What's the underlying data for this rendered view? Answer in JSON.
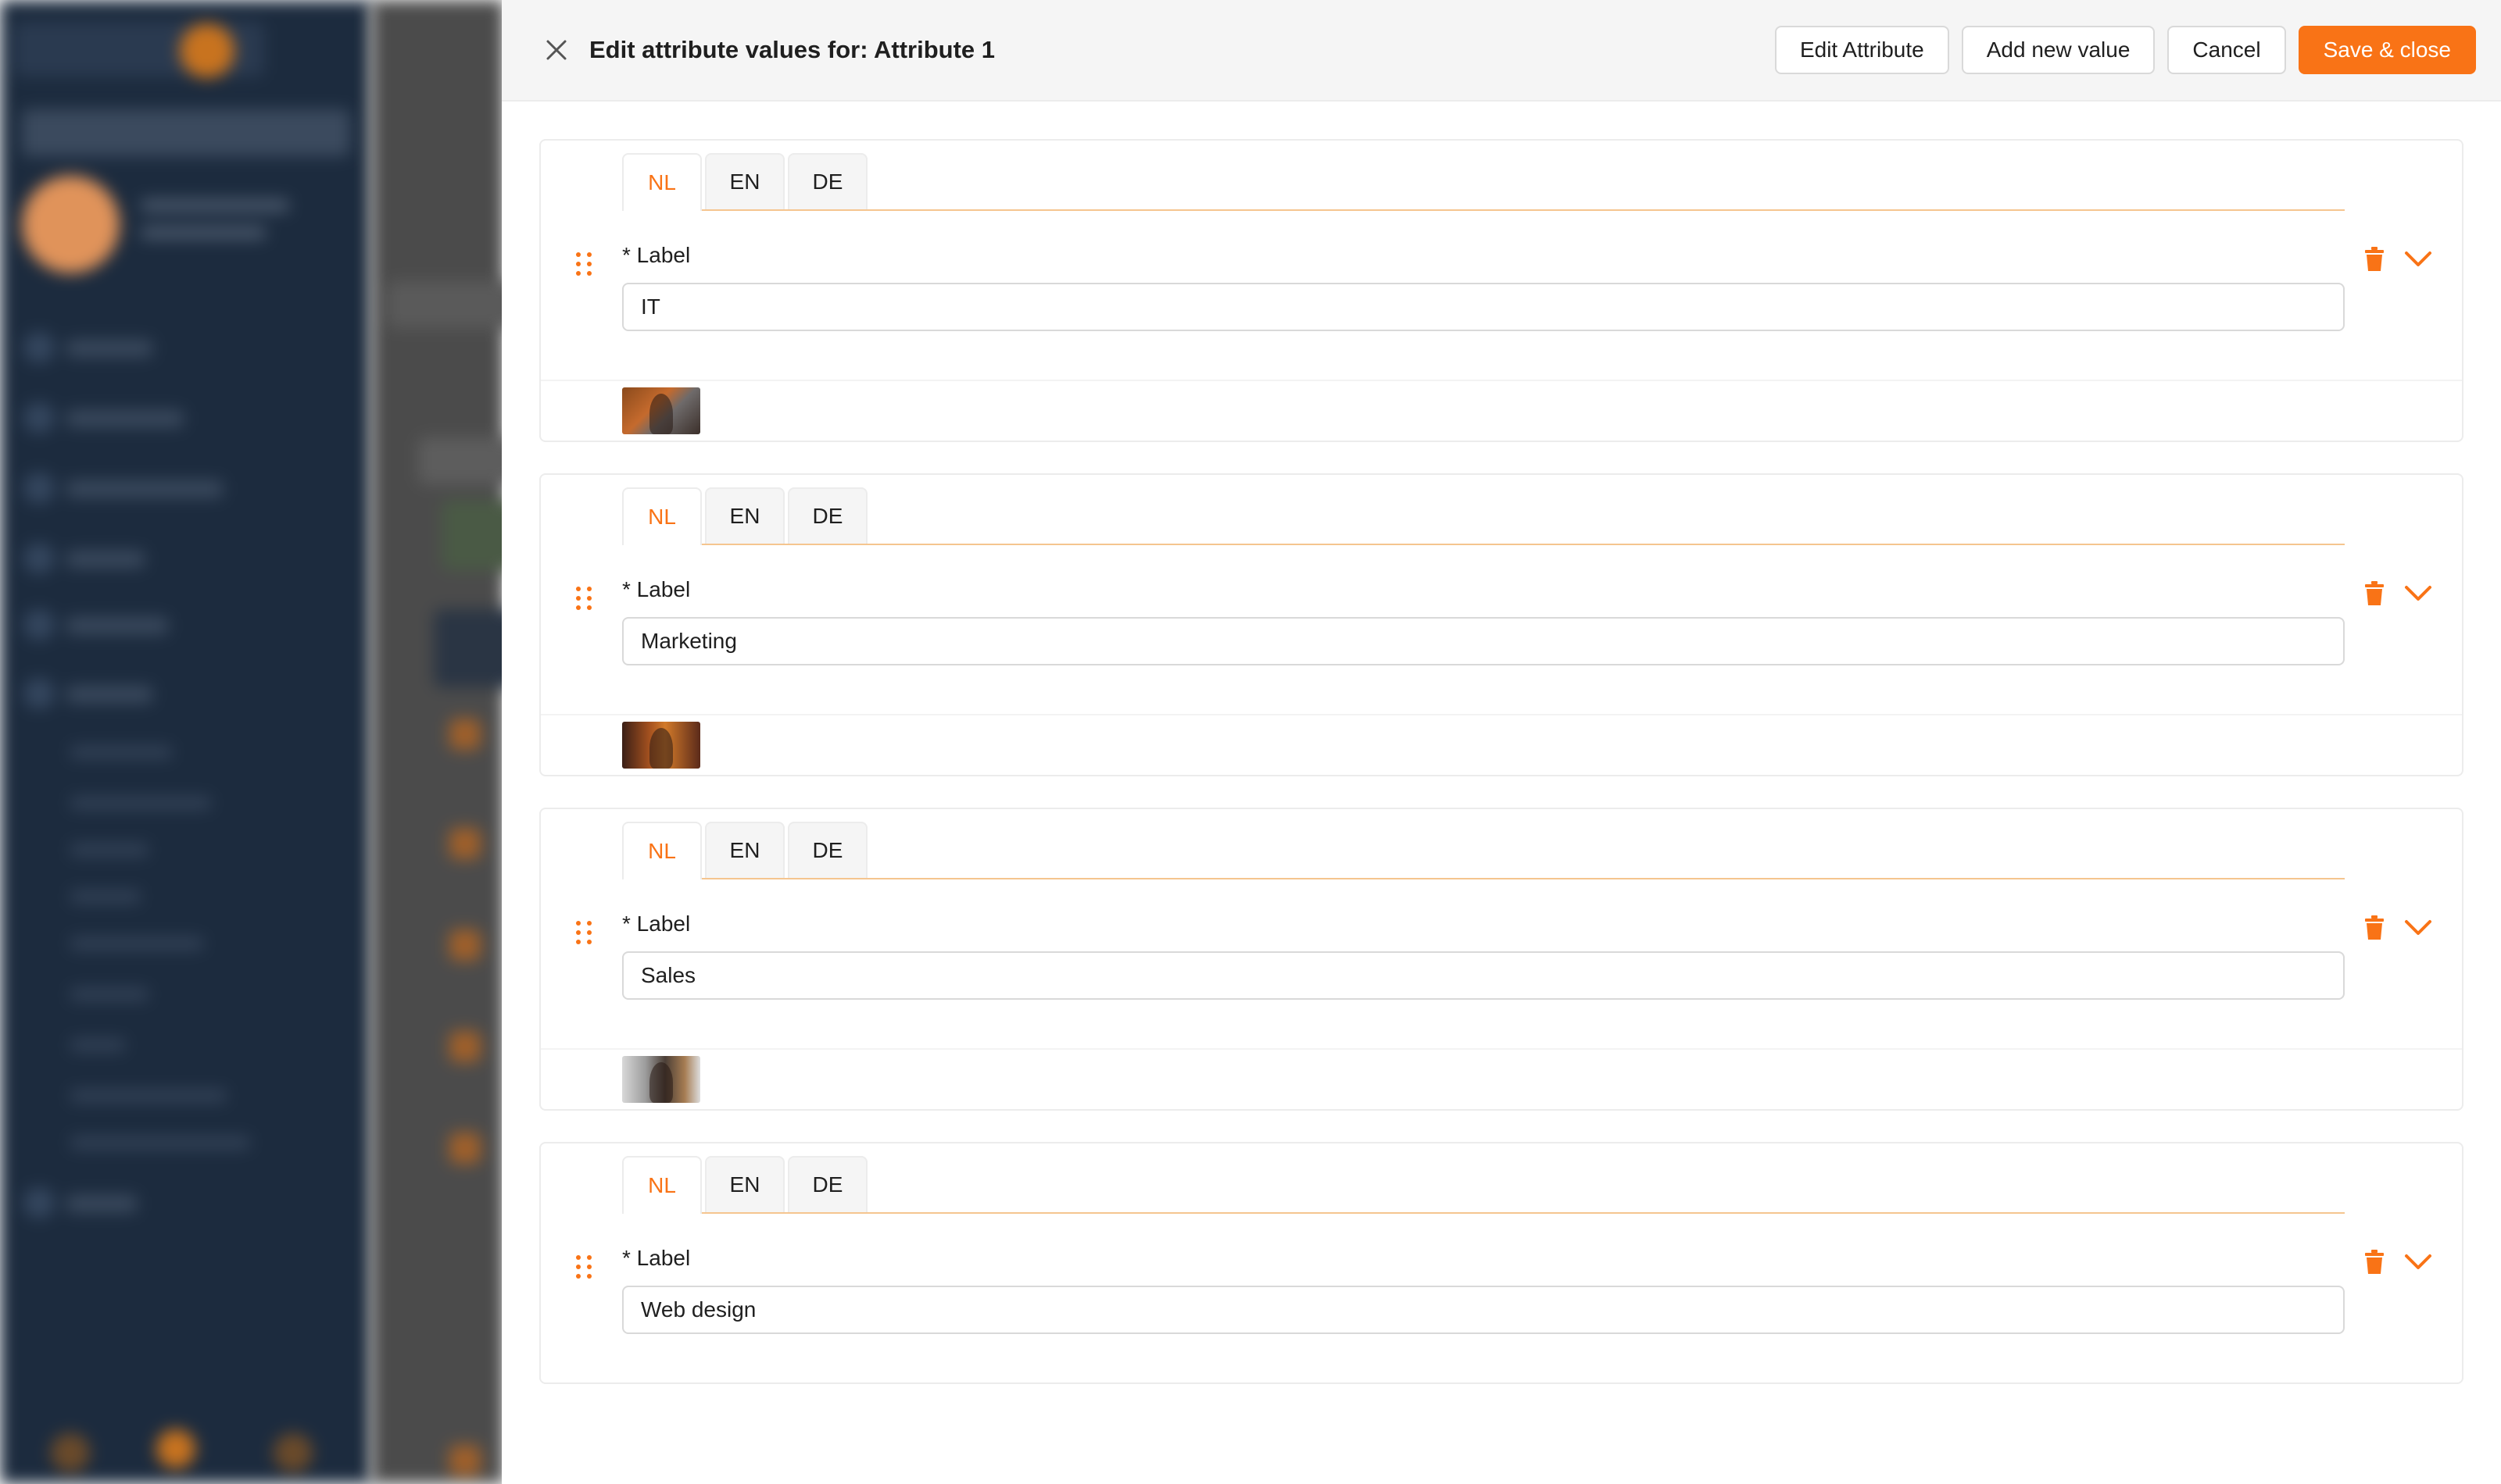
{
  "drawer": {
    "title": "Edit attribute values for: Attribute 1",
    "close_icon": "close-icon",
    "buttons": {
      "edit_attribute": "Edit Attribute",
      "add_new_value": "Add new value",
      "cancel": "Cancel",
      "save_close": "Save & close"
    }
  },
  "languages": [
    "NL",
    "EN",
    "DE"
  ],
  "active_language": "NL",
  "values": [
    {
      "label": "* Label",
      "value": "IT",
      "has_image": true
    },
    {
      "label": "* Label",
      "value": "Marketing",
      "has_image": true
    },
    {
      "label": "* Label",
      "value": "Sales",
      "has_image": true
    },
    {
      "label": "* Label",
      "value": "Web design",
      "has_image": false
    }
  ],
  "colors": {
    "accent": "#f97316",
    "header_bg": "#f5f5f5",
    "sidebar_bg": "#1c2b3e"
  }
}
